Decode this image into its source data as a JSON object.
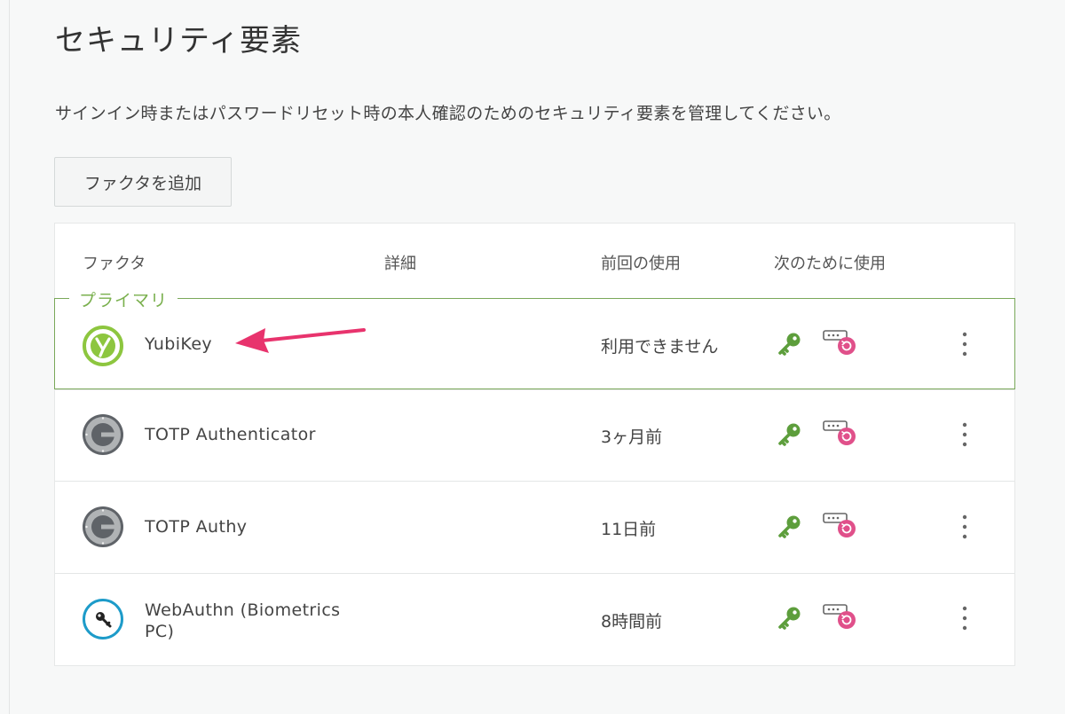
{
  "page": {
    "title": "セキュリティ要素",
    "description": "サインイン時またはパスワードリセット時の本人確認のためのセキュリティ要素を管理してください。",
    "add_button_label": "ファクタを追加"
  },
  "table": {
    "headers": {
      "factor": "ファクタ",
      "details": "詳細",
      "last_used": "前回の使用",
      "used_for": "次のために使用"
    },
    "primary_label": "プライマリ",
    "rows": [
      {
        "name": "YubiKey",
        "last_used": "利用できません",
        "icon": "yubikey-icon"
      },
      {
        "name": "TOTP Authenticator",
        "last_used": "3ヶ月前",
        "icon": "google-authenticator-icon"
      },
      {
        "name": "TOTP Authy",
        "last_used": "11日前",
        "icon": "google-authenticator-icon"
      },
      {
        "name_line1": "WebAuthn (Biometrics",
        "name_line2": "PC)",
        "last_used": "8時間前",
        "icon": "webauthn-key-icon"
      }
    ],
    "usage_icons": [
      "sign-in-key-icon",
      "password-reset-icon"
    ]
  },
  "colors": {
    "primary_border": "#7aa85a",
    "primary_label": "#7ab04e",
    "key_green": "#5d9e3c",
    "reset_pink": "#e0508a",
    "annotation_arrow": "#e8336d"
  }
}
